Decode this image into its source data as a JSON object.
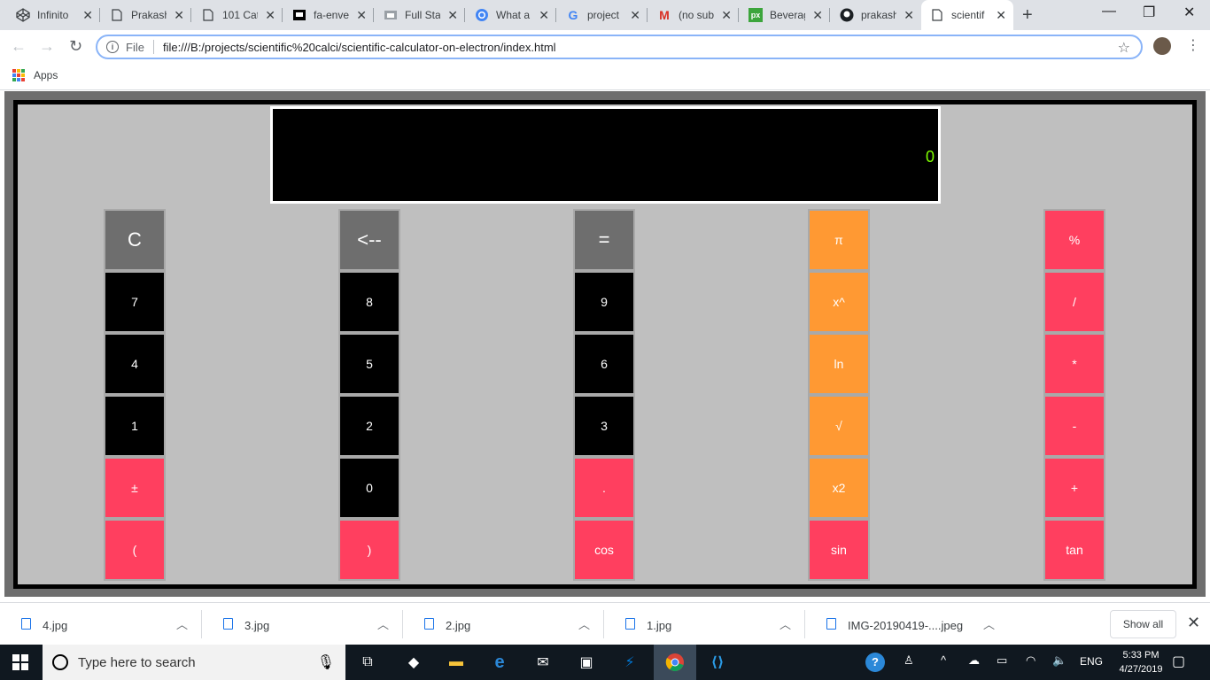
{
  "browser": {
    "tabs": [
      {
        "title": "Infinito",
        "icon": "codepen-icon",
        "left": 0
      },
      {
        "title": "Prakash",
        "icon": "page-icon"
      },
      {
        "title": "101 Cat",
        "icon": "page-icon"
      },
      {
        "title": "fa-enve",
        "icon": "flag-icon"
      },
      {
        "title": "Full Sta",
        "icon": "image-icon"
      },
      {
        "title": "What a",
        "icon": "chrome-icon"
      },
      {
        "title": "project",
        "icon": "google-icon"
      },
      {
        "title": "(no sub",
        "icon": "gmail-icon"
      },
      {
        "title": "Beverag",
        "icon": "px-icon"
      },
      {
        "title": "prakash",
        "icon": "github-icon"
      },
      {
        "title": "scientif",
        "icon": "page-icon",
        "active": true
      }
    ],
    "address": {
      "scheme": "File",
      "url": "file:///B:/projects/scientific%20calci/scientific-calculator-on-electron/index.html"
    },
    "bookmarks": {
      "apps_label": "Apps"
    }
  },
  "calculator": {
    "display_value": "0",
    "keys": {
      "clear": "C",
      "back": "<--",
      "equals": "=",
      "pi": "π",
      "percent": "%",
      "seven": "7",
      "eight": "8",
      "nine": "9",
      "power": "x^",
      "divide": "/",
      "four": "4",
      "five": "5",
      "six": "6",
      "ln": "ln",
      "multiply": "*",
      "one": "1",
      "two": "2",
      "three": "3",
      "sqrt": "√",
      "minus": "-",
      "plusminus": "±",
      "zero": "0",
      "dot": ".",
      "square": "x2",
      "plus": "+",
      "lparen": "(",
      "rparen": ")",
      "cos": "cos",
      "sin": "sin",
      "tan": "tan"
    },
    "colors": {
      "gray": "#6e6e6e",
      "black": "#000000",
      "orange": "#ff9933",
      "red": "#ff3f5f",
      "display_text": "#7fff00"
    }
  },
  "downloads": {
    "items": [
      "4.jpg",
      "3.jpg",
      "2.jpg",
      "1.jpg",
      "IMG-20190419-....jpeg"
    ],
    "show_all": "Show all"
  },
  "taskbar": {
    "search_placeholder": "Type here to search",
    "language": "ENG",
    "time": "5:33 PM",
    "date": "4/27/2019"
  }
}
